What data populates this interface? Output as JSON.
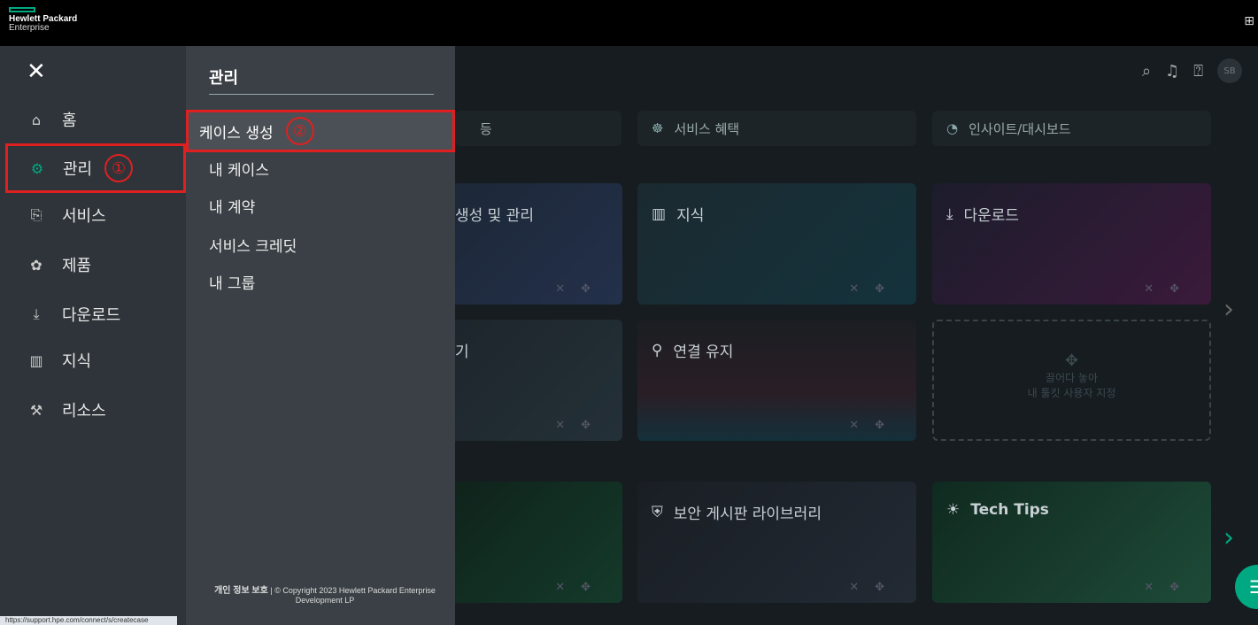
{
  "brand": {
    "line1": "Hewlett Packard",
    "line2": "Enterprise",
    "accent": "#01a982"
  },
  "header": {
    "avatar": "SB"
  },
  "nav": {
    "items": [
      {
        "label": "홈",
        "icon": "home-icon"
      },
      {
        "label": "관리",
        "icon": "manage-icon",
        "annotation": "①"
      },
      {
        "label": "서비스",
        "icon": "services-icon"
      },
      {
        "label": "제품",
        "icon": "products-icon"
      },
      {
        "label": "다운로드",
        "icon": "download-icon"
      },
      {
        "label": "지식",
        "icon": "book-icon"
      },
      {
        "label": "리소스",
        "icon": "tools-icon"
      }
    ]
  },
  "submenu": {
    "title": "관리",
    "items": [
      {
        "label": "케이스 생성",
        "annotation": "②"
      },
      {
        "label": "내 케이스"
      },
      {
        "label": "내 계약"
      },
      {
        "label": "서비스 크레딧"
      },
      {
        "label": "내 그룹"
      }
    ],
    "footer": {
      "privacy": "개인 정보 보호",
      "separator": "|",
      "copyright": "© Copyright 2023 Hewlett Packard Enterprise Development LP"
    }
  },
  "background": {
    "pills": [
      {
        "label": "등"
      },
      {
        "label": "서비스 혜택"
      },
      {
        "label": "인사이트/대시보드"
      }
    ],
    "tiles": [
      {
        "label": "생성 및 관리"
      },
      {
        "label": "지식"
      },
      {
        "label": "다운로드"
      },
      {
        "label": "기"
      },
      {
        "label": "연결 유지"
      },
      {
        "label": "보안 게시판 라이브러리"
      },
      {
        "label": "Tech Tips"
      }
    ],
    "dropzone": {
      "line1": "끌어다 놓아",
      "line2": "내 툴킷 사용자 지정"
    }
  },
  "status_url": "https://support.hpe.com/connect/s/createcase"
}
